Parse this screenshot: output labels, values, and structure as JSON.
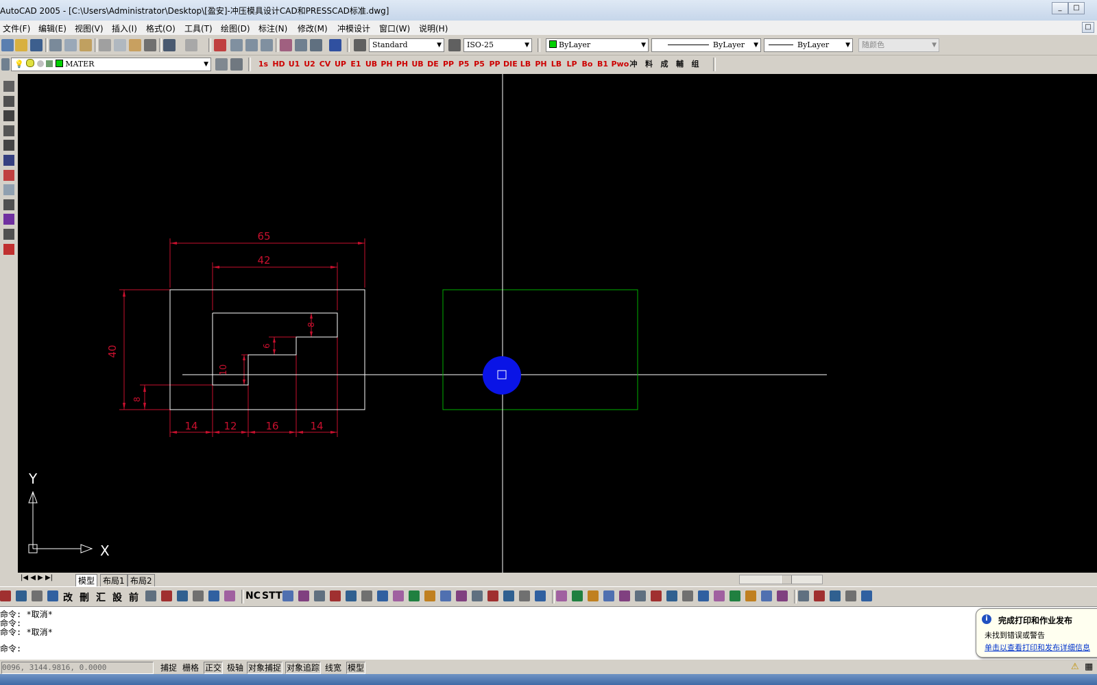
{
  "window": {
    "title": "AutoCAD 2005 - [C:\\Users\\Administrator\\Desktop\\[盈安]-冲压模具设计CAD和PRESSCAD标准.dwg]"
  },
  "menu": [
    "文件(F)",
    "编辑(E)",
    "视图(V)",
    "插入(I)",
    "格式(O)",
    "工具(T)",
    "绘图(D)",
    "标注(N)",
    "修改(M)",
    "冲模设计",
    "窗口(W)",
    "说明(H)"
  ],
  "toolbar": {
    "text_style": "Standard",
    "dim_style": "ISO-25",
    "color": "ByLayer",
    "linetype": "ByLayer",
    "lineweight": "ByLayer",
    "plotstyle": "随颜色",
    "layer": "MATER"
  },
  "presscad_buttons": [
    "1s",
    "HD",
    "U1",
    "U2",
    "CV",
    "UP",
    "E1",
    "UB",
    "PH",
    "PH",
    "UB",
    "DE",
    "PP",
    "P5",
    "P5",
    "PP",
    "DIE",
    "LB",
    "PH",
    "LB",
    "LP",
    "Bo",
    "B1",
    "Pwo",
    "冲",
    "料",
    "成",
    "輔",
    "组"
  ],
  "left_tool_icons": [
    "punch-icon",
    "punch2-icon",
    "die-icon",
    "strip-icon",
    "lp-icon",
    "layer-plate-icon",
    "cloud-icon",
    "rect-icon",
    "hatch-icon",
    "block-icon",
    "part-icon",
    "aux-icon"
  ],
  "drawing": {
    "dims": {
      "overall_width": "65",
      "inner_width": "42",
      "height": "40",
      "h8_top": "8",
      "h6": "6",
      "h10": "10",
      "h8_bottom": "8",
      "b1": "14",
      "b2": "12",
      "b3": "16",
      "b4": "14"
    },
    "ucs": {
      "x": "X",
      "y": "Y"
    },
    "colors": {
      "dim": "#c8102e",
      "part": "#ffffff",
      "box": "#00b000",
      "marker": "#0a14e6"
    }
  },
  "tabs": {
    "model": "模型",
    "layout1": "布局1",
    "layout2": "布局2"
  },
  "bottom_buttons": [
    "改",
    "刪",
    "汇",
    "設",
    "前",
    "STT",
    "NC"
  ],
  "command": {
    "lines": [
      "命令: *取消*",
      "命令:",
      "命令: *取消*"
    ],
    "prompt": "命令:"
  },
  "status": {
    "coords": "0096, 3144.9816, 0.0000",
    "buttons": [
      {
        "label": "捕捉",
        "on": false
      },
      {
        "label": "栅格",
        "on": false
      },
      {
        "label": "正交",
        "on": true
      },
      {
        "label": "极轴",
        "on": false
      },
      {
        "label": "对象捕捉",
        "on": true
      },
      {
        "label": "对象追踪",
        "on": true
      },
      {
        "label": "线宽",
        "on": false
      },
      {
        "label": "模型",
        "on": true
      }
    ]
  },
  "balloon": {
    "title": "完成打印和作业发布",
    "line1": "未找到错误或警告",
    "link": "单击以查看打印和发布详细信息"
  }
}
